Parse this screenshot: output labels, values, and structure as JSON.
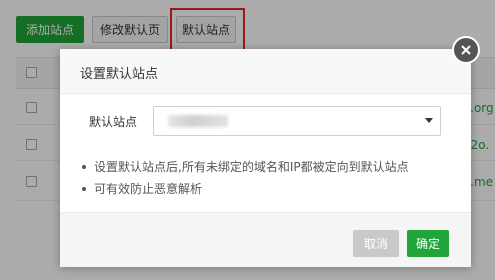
{
  "toolbar": {
    "add_site": "添加站点",
    "edit_default_page": "修改默认页",
    "default_site": "默认站点"
  },
  "background_table": {
    "row_link_fragments": [
      "o.org",
      "52o.",
      "o.me"
    ]
  },
  "modal": {
    "title": "设置默认站点",
    "field_label": "默认站点",
    "select_value": "",
    "tips": [
      "设置默认站点后,所有未绑定的域名和IP都被定向到默认站点",
      "可有效防止恶意解析"
    ],
    "cancel_label": "取消",
    "confirm_label": "确定"
  },
  "colors": {
    "primary_green": "#20a53a",
    "highlight_red": "#e0262b",
    "disabled_gray": "#c9c9c9"
  }
}
